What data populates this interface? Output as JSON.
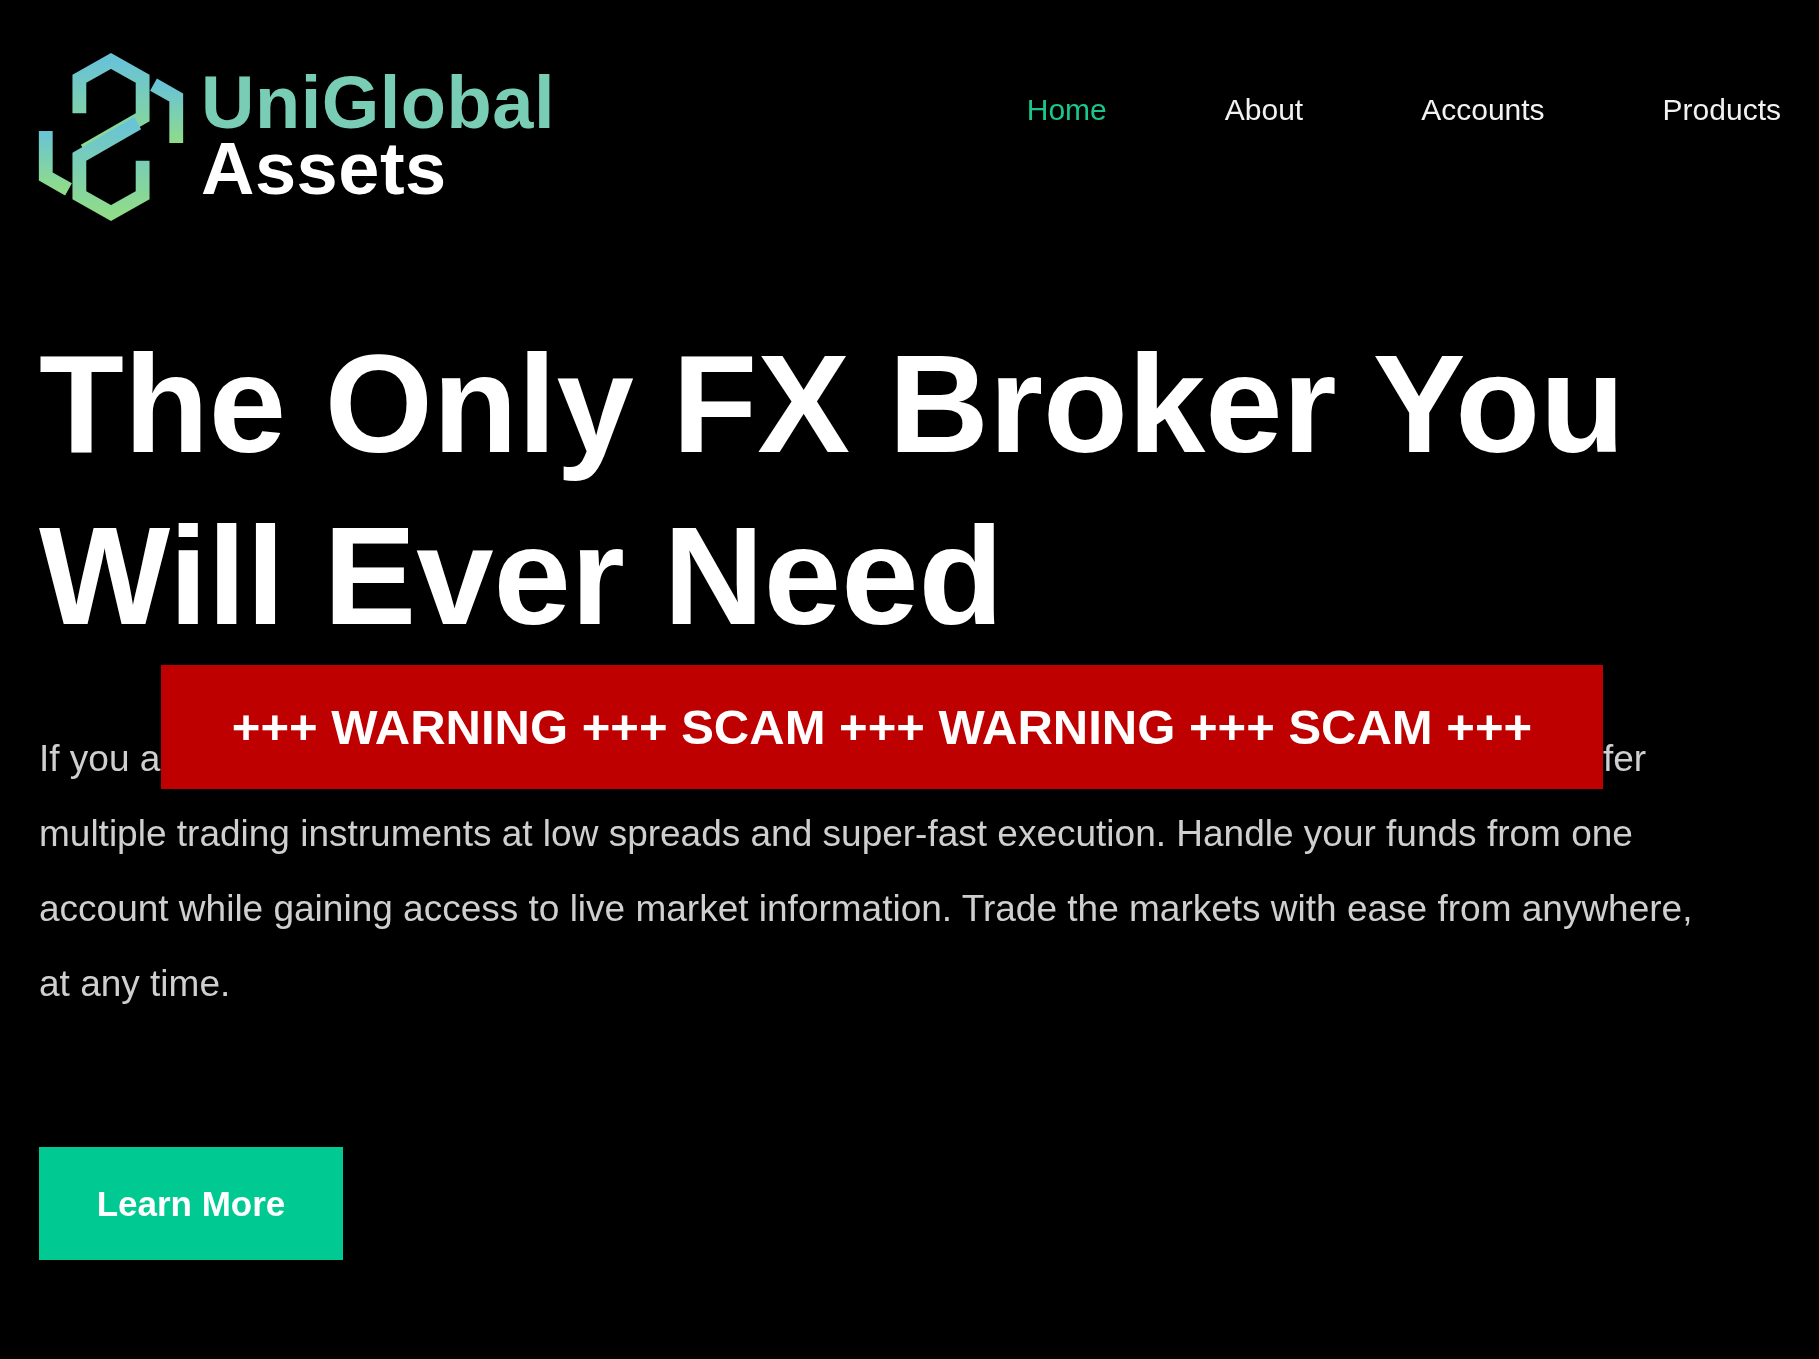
{
  "header": {
    "logo": {
      "top_text": "UniGlobal",
      "bottom_text": "Assets"
    },
    "nav": [
      {
        "label": "Home",
        "selected": true
      },
      {
        "label": "About",
        "selected": false
      },
      {
        "label": "Accounts",
        "selected": false
      },
      {
        "label": "Products",
        "selected": false
      }
    ]
  },
  "hero": {
    "heading": "The Only FX Broker You Will Ever Need",
    "intro_visible_start": "If you a",
    "intro_visible_end": "fer",
    "intro_lines": [
      "multiple trading instruments at low spreads and super-fast execution. Handle your funds from one",
      "account while gaining access to live market information. Trade the markets with ease from anywhere,",
      "at any time."
    ],
    "button": "Learn More"
  },
  "overlay_banner": {
    "text": "+++ WARNING +++ SCAM +++ WARNING +++ SCAM +++"
  }
}
